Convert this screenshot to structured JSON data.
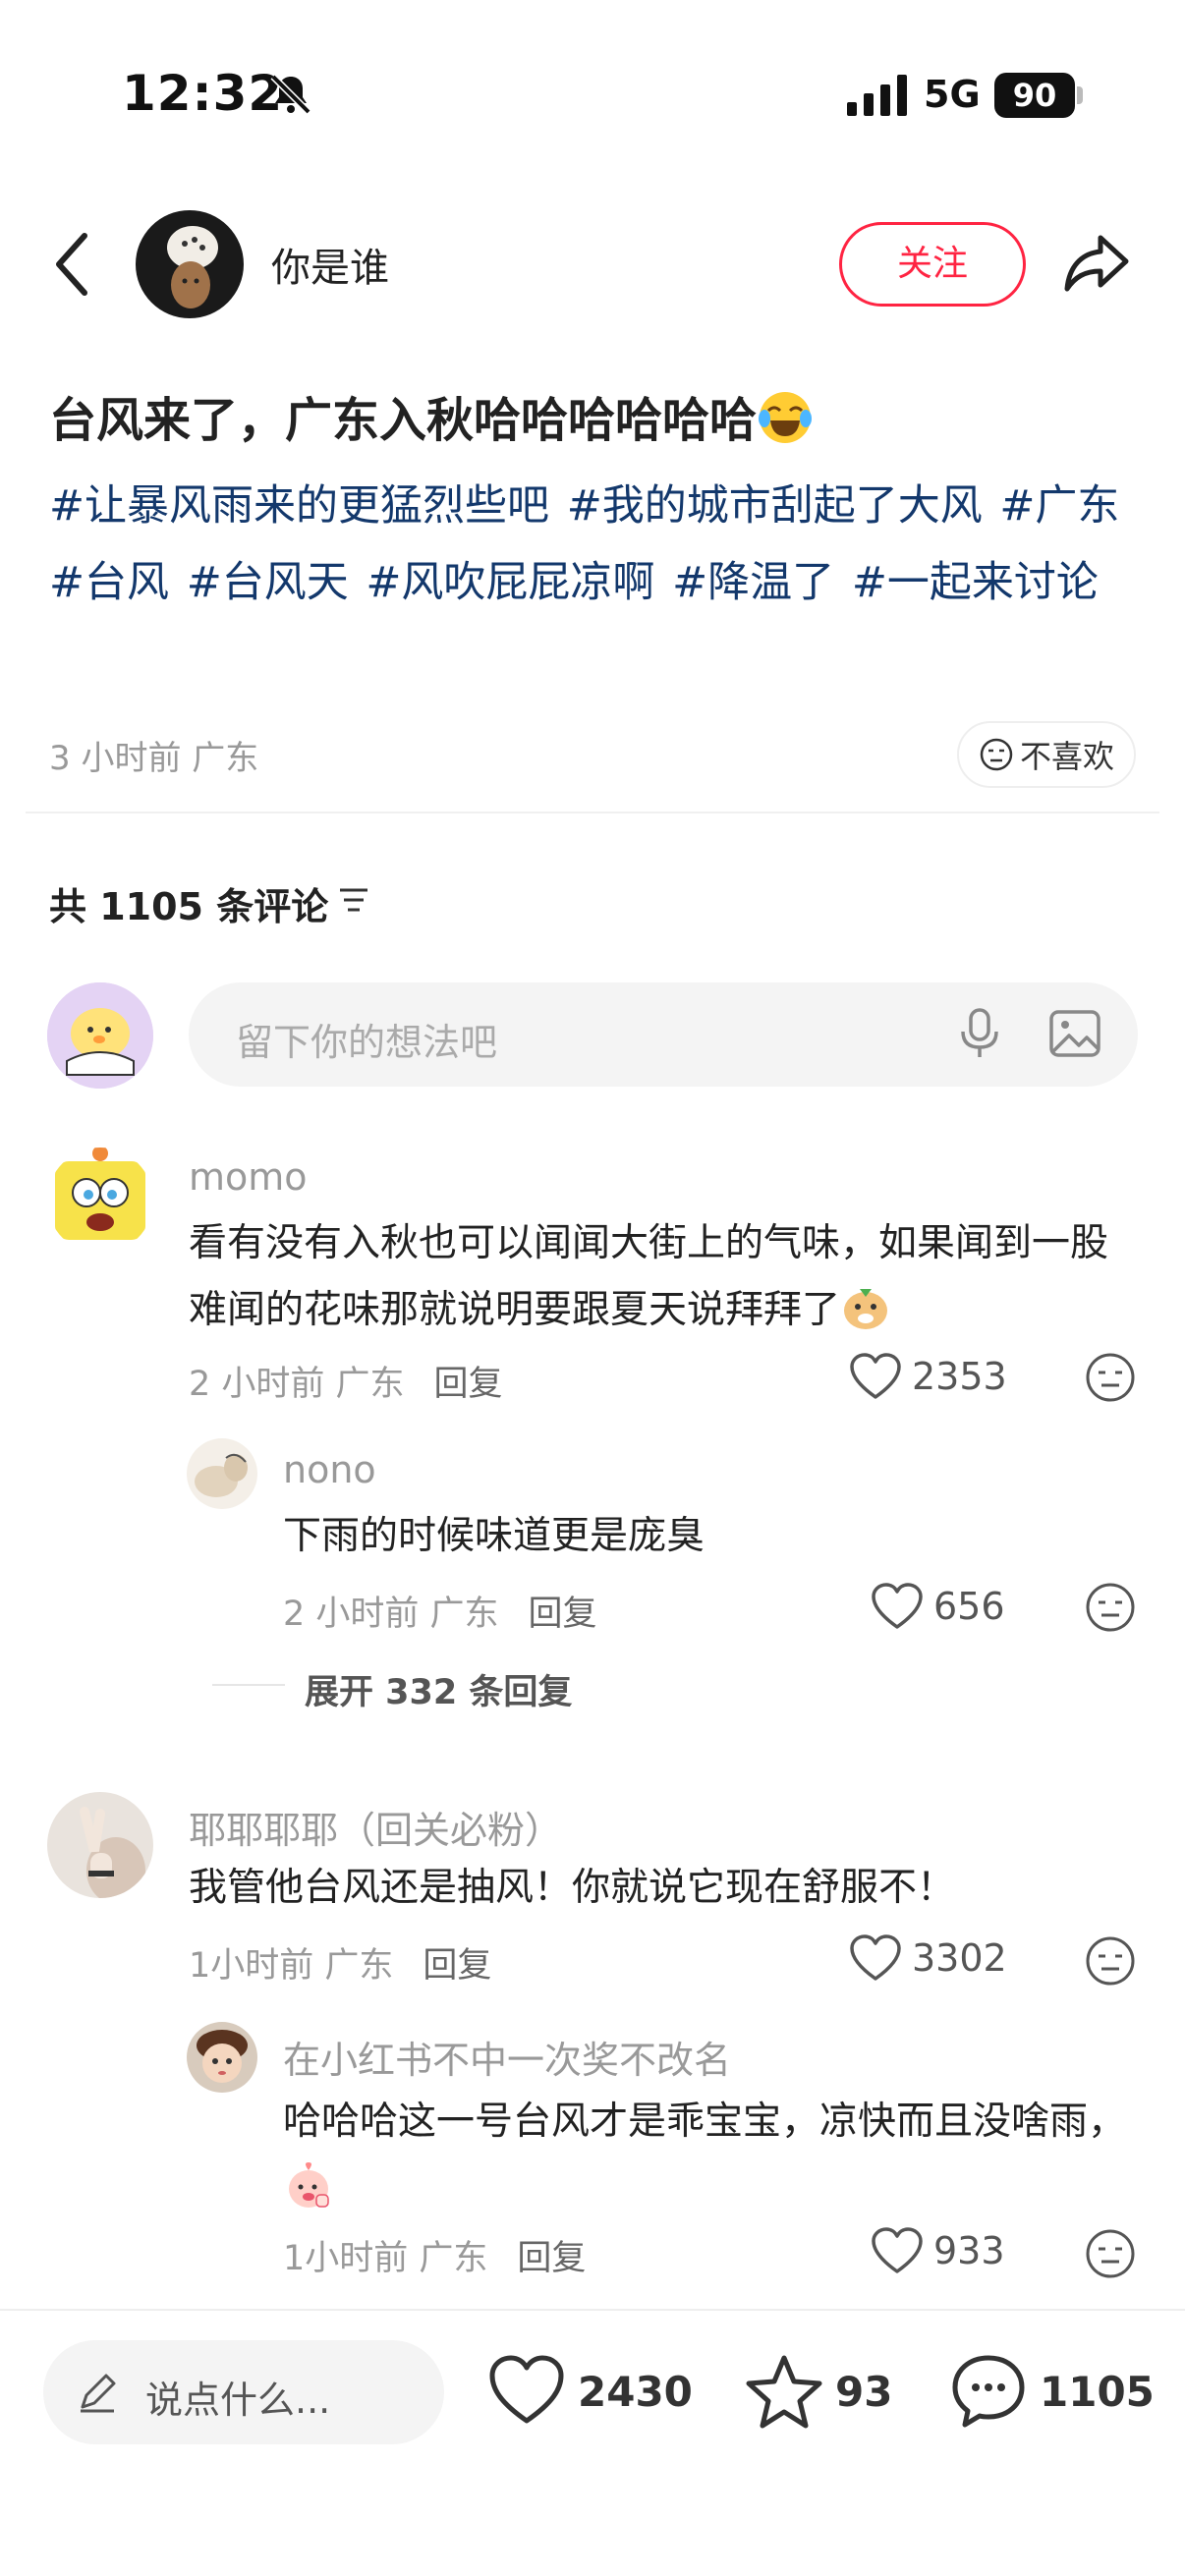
{
  "status_bar": {
    "time": "12:32",
    "network": "5G",
    "battery": "90"
  },
  "header": {
    "author": "你是谁",
    "follow_label": "关注"
  },
  "post": {
    "title": "台风来了，广东入秋哈哈哈哈哈哈",
    "title_emoji": "laughing-tears-emoji",
    "tags": [
      "#让暴风雨来的更猛烈些吧",
      "#我的城市刮起了大风",
      "#广东",
      "#台风",
      "#台风天",
      "#风吹屁屁凉啊",
      "#降温了",
      "#一起来讨论"
    ],
    "meta": "3 小时前 广东",
    "dislike_label": "不喜欢"
  },
  "comments_header": {
    "count_label": "共 1105 条评论"
  },
  "comment_input": {
    "placeholder": "留下你的想法吧"
  },
  "comments": [
    {
      "name": "momo",
      "text": "看有没有入秋也可以闻闻大街上的气味，如果闻到一股难闻的花味那就说明要跟夏天说拜拜了",
      "meta": "2 小时前 广东",
      "reply_label": "回复",
      "likes": "2353",
      "replies": [
        {
          "name": "nono",
          "text": "下雨的时候味道更是庞臭",
          "meta": "2 小时前 广东",
          "reply_label": "回复",
          "likes": "656"
        }
      ],
      "expand_label": "展开 332 条回复"
    },
    {
      "name": "耶耶耶耶（回关必粉）",
      "text": "我管他台风还是抽风！你就说它现在舒服不！",
      "meta": "1小时前 广东",
      "reply_label": "回复",
      "likes": "3302",
      "replies": [
        {
          "name": "在小红书不中一次奖不改名",
          "text": "哈哈哈这一号台风才是乖宝宝，凉快而且没啥雨，",
          "meta": "1小时前 广东",
          "reply_label": "回复",
          "likes": "933"
        }
      ]
    }
  ],
  "bottom_bar": {
    "say_label": "说点什么...",
    "likes": "2430",
    "stars": "93",
    "comments": "1105"
  },
  "colors": {
    "accent": "#ff2442",
    "tag": "#13386c",
    "muted": "#999999"
  }
}
